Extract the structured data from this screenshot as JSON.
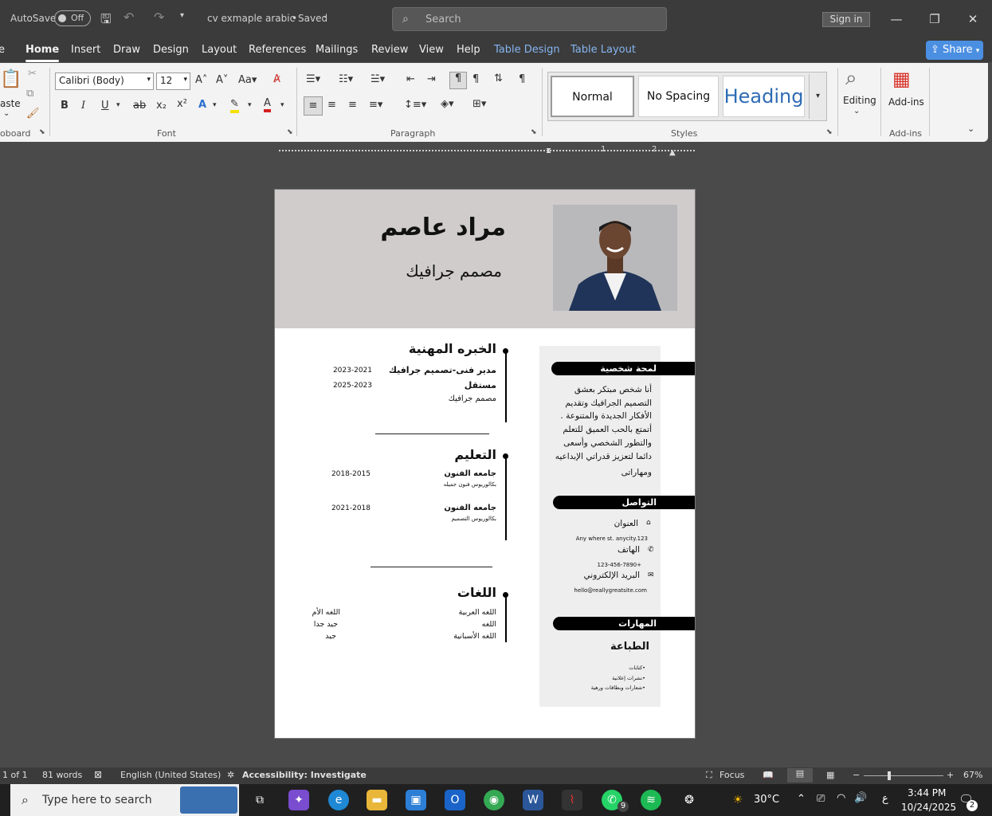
{
  "titlebar": {
    "autosave_label": "AutoSave",
    "autosave_state": "Off",
    "doc_title": "cv exmaple arabic",
    "saved_state": "Saved",
    "search_placeholder": "Search",
    "signin_label": "Sign in"
  },
  "tabs": [
    {
      "label": "e"
    },
    {
      "label": "Home"
    },
    {
      "label": "Insert"
    },
    {
      "label": "Draw"
    },
    {
      "label": "Design"
    },
    {
      "label": "Layout"
    },
    {
      "label": "References"
    },
    {
      "label": "Mailings"
    },
    {
      "label": "Review"
    },
    {
      "label": "View"
    },
    {
      "label": "Help"
    },
    {
      "label": "Table Design"
    },
    {
      "label": "Table Layout"
    }
  ],
  "share_label": "Share",
  "ribbon": {
    "clipboard_name": "oboard",
    "paste_label": "aste",
    "font_group_name": "Font",
    "font_name": "Calibri (Body)",
    "font_size": "12",
    "paragraph_group_name": "Paragraph",
    "styles_group_name": "Styles",
    "styles": [
      {
        "label": "Normal"
      },
      {
        "label": "No Spacing"
      },
      {
        "label": "Heading"
      }
    ],
    "editing_label": "Editing",
    "addins_label": "Add-ins",
    "addins_group_name": "Add-ins",
    "ruler_marks": [
      "1",
      "2"
    ]
  },
  "resume": {
    "name": "مراد عاصم",
    "title": "مصمم جرافيك",
    "experience": {
      "heading": "الخبره المهنية",
      "items": [
        {
          "role": "مدير فنى-تصميم جرافيك",
          "years": "2023-2021"
        },
        {
          "role": "مستقل",
          "years": "2025-2023"
        },
        {
          "role": "مصمم جرافيك",
          "years": ""
        }
      ]
    },
    "education": {
      "heading": "التعليم",
      "items": [
        {
          "school": "جامعه الفنون",
          "degree": "بكالوريوس فنون جميله",
          "years": "2018-2015"
        },
        {
          "school": "جامعه الفنون",
          "degree": "بكالوريوس التصميم",
          "years": "2021-2018"
        }
      ]
    },
    "languages": {
      "heading": "اللغات",
      "items": [
        {
          "name": "اللغه العربية",
          "level": "اللغه الأم"
        },
        {
          "name": "اللغه",
          "level": "جيد جدا"
        },
        {
          "name": "اللغه الأسبانية",
          "level": "جيد"
        }
      ]
    },
    "profile": {
      "heading": "لمحة شخصية",
      "lines": [
        "أنا شخص مبتكر بعشق",
        "التصميم الجرافيك وتقديم",
        "الأفكار الجديدة والمتنوعة .",
        "أتمتع بالحب العميق للتعلم",
        "والتطور الشخصي وأسعى",
        "دائما لتعزيز قدراتي الإبداعيه",
        "ومهاراتى"
      ]
    },
    "contact": {
      "heading": "التواصل",
      "address_label": "العنوان",
      "address_value": "Any where st. anycity.123",
      "phone_label": "الهاتف",
      "phone_value": "123-456-7890+",
      "email_label": "البريد الإلكتروني",
      "email_value": "hello@reallygreatsite.com"
    },
    "skills": {
      "heading": "المهارات",
      "subheading": "الطباعة",
      "items": [
        "•كتابات",
        "•نشرات إعلانية",
        "•شعارات وبطاقات ورهية"
      ]
    }
  },
  "status": {
    "page": "1 of 1",
    "words": "81 words",
    "language": "English (United States)",
    "accessibility": "Accessibility: Investigate",
    "focus": "Focus",
    "zoom": "67%"
  },
  "taskbar": {
    "search_placeholder": "Type here to search",
    "temperature": "30°C",
    "time": "3:44 PM",
    "date": "10/24/2025",
    "lang_indicator": "ع",
    "whatsapp_badge": "9",
    "notification_badge": "2"
  },
  "colors": {
    "accent": "#4b8fe3",
    "header_band": "#d0cccc",
    "sidebar": "#eeeeee"
  }
}
